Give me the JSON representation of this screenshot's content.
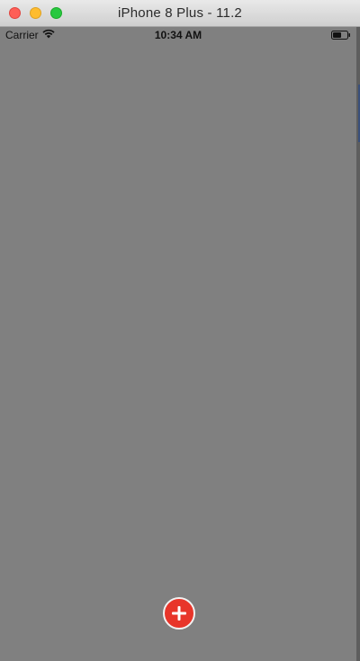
{
  "window": {
    "title": "iPhone 8 Plus - 11.2"
  },
  "status_bar": {
    "carrier": "Carrier",
    "time": "10:34 AM",
    "icons": [
      "wifi-icon",
      "battery-icon"
    ]
  },
  "fab": {
    "icon": "plus-icon",
    "color": "#e8352a"
  },
  "colors": {
    "screen_background": "#808080"
  }
}
